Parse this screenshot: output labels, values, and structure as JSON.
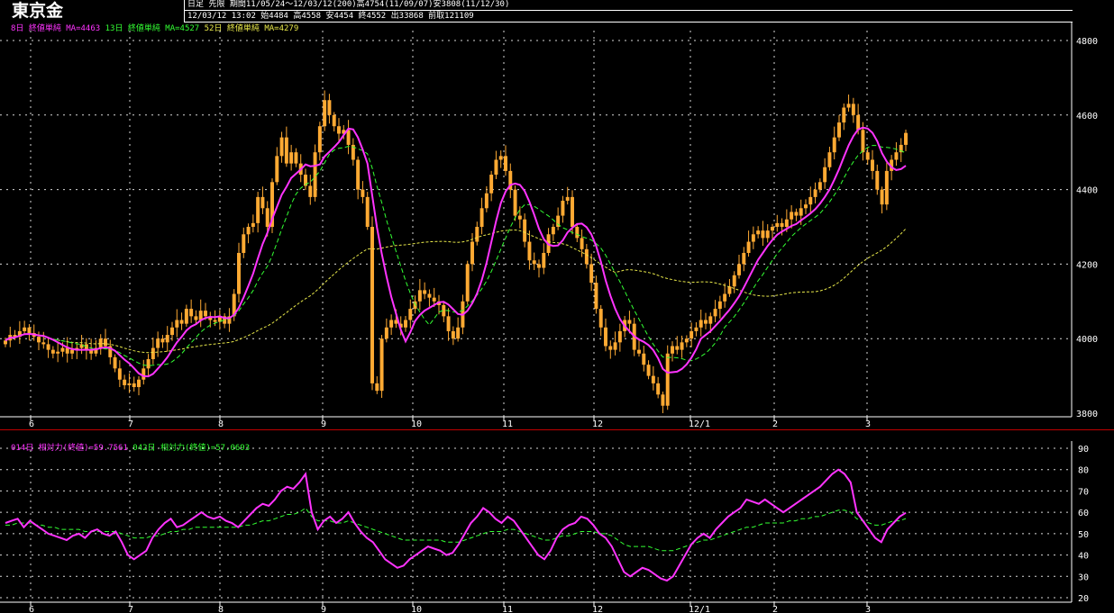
{
  "header": {
    "title": "東京金",
    "mode": "日足",
    "contract": "先限",
    "period": "期間11/05/24〜12/03/12(200)",
    "high": "高4754(11/09/07)",
    "low": "安3808(11/12/30)",
    "ohlc": "12/03/12 13:02 始4484 高4558 安4454 終4552 出33868 前取121109"
  },
  "legend_main": [
    {
      "text": "8日 終値単純 MA=4463",
      "color": "#ff33ff"
    },
    {
      "text": "13日 終値単純 MA=4527",
      "color": "#33ff33"
    },
    {
      "text": "52日 終値単純 MA=4279",
      "color": "#e8e84a"
    }
  ],
  "legend_sub": [
    {
      "text": "014日 相対力(終値)=59.7561",
      "color": "#ff33ff"
    },
    {
      "text": "042日 相対力(終値)=57.0693",
      "color": "#33ff33"
    }
  ],
  "colors": {
    "candle": "#ffaa33",
    "ma8": "#ff33ff",
    "ma13": "#33ff33",
    "ma52": "#e8e84a",
    "grid": "#ffffff",
    "separator": "#c00000"
  },
  "chart_data": [
    {
      "type": "candlestick",
      "title": "東京金",
      "ylim": [
        3800,
        4800
      ],
      "yticks": [
        3800,
        4000,
        4200,
        4400,
        4600,
        4800
      ],
      "xlabels": [
        "6",
        "7",
        "8",
        "9",
        "10",
        "11",
        "12",
        "12/1",
        "2",
        "3"
      ],
      "close": [
        3995,
        4010,
        4005,
        4020,
        4030,
        4015,
        4005,
        3990,
        3985,
        3970,
        3960,
        3965,
        3975,
        3960,
        3970,
        3975,
        3985,
        3970,
        3960,
        3975,
        4000,
        3980,
        3950,
        3920,
        3890,
        3875,
        3880,
        3870,
        3890,
        3920,
        3945,
        3975,
        4000,
        3990,
        4010,
        4030,
        4050,
        4040,
        4080,
        4060,
        4050,
        4075,
        4060,
        4050,
        4045,
        4060,
        4040,
        4060,
        4120,
        4230,
        4280,
        4300,
        4310,
        4380,
        4350,
        4300,
        4420,
        4490,
        4540,
        4470,
        4500,
        4470,
        4440,
        4410,
        4380,
        4500,
        4570,
        4640,
        4600,
        4570,
        4550,
        4560,
        4520,
        4480,
        4400,
        4380,
        4300,
        3880,
        3860,
        4000,
        4030,
        4050,
        4040,
        4030,
        4050,
        4080,
        4100,
        4130,
        4120,
        4110,
        4100,
        4090,
        4060,
        4020,
        4000,
        4030,
        4100,
        4200,
        4260,
        4300,
        4350,
        4390,
        4440,
        4480,
        4490,
        4450,
        4400,
        4330,
        4320,
        4260,
        4210,
        4200,
        4190,
        4230,
        4280,
        4300,
        4330,
        4370,
        4380,
        4300,
        4270,
        4240,
        4200,
        4150,
        4080,
        4030,
        3980,
        3970,
        3990,
        4020,
        4050,
        4040,
        3970,
        3960,
        3930,
        3900,
        3880,
        3850,
        3820,
        3960,
        3980,
        3970,
        3990,
        4000,
        4020,
        4030,
        4050,
        4040,
        4060,
        4080,
        4100,
        4120,
        4140,
        4170,
        4200,
        4230,
        4260,
        4280,
        4290,
        4270,
        4290,
        4300,
        4310,
        4300,
        4320,
        4340,
        4330,
        4350,
        4360,
        4380,
        4400,
        4420,
        4460,
        4500,
        4540,
        4580,
        4620,
        4630,
        4600,
        4560,
        4500,
        4480,
        4450,
        4400,
        4360,
        4450,
        4480,
        4500,
        4520,
        4552
      ],
      "ma8_last": 4463,
      "ma13_last": 4527,
      "ma52_last": 4279
    },
    {
      "type": "line",
      "ylim": [
        20,
        90
      ],
      "yticks": [
        20,
        30,
        40,
        50,
        60,
        70,
        80,
        90
      ],
      "xlabels": [
        "6",
        "7",
        "8",
        "9",
        "10",
        "11",
        "12",
        "12/1",
        "2",
        "3"
      ],
      "series": [
        {
          "name": "014日 相対力(終値)",
          "values": [
            55,
            56,
            57,
            53,
            56,
            54,
            52,
            50,
            49,
            48,
            47,
            49,
            50,
            48,
            51,
            52,
            50,
            49,
            51,
            46,
            40,
            38,
            40,
            42,
            48,
            52,
            55,
            57,
            53,
            54,
            56,
            58,
            60,
            58,
            57,
            58,
            56,
            55,
            53,
            56,
            59,
            62,
            64,
            63,
            66,
            70,
            72,
            71,
            74,
            78,
            60,
            52,
            56,
            58,
            55,
            57,
            60,
            55,
            51,
            48,
            46,
            42,
            38,
            36,
            34,
            35,
            38,
            40,
            42,
            44,
            43,
            42,
            40,
            41,
            45,
            50,
            55,
            58,
            62,
            60,
            57,
            55,
            58,
            56,
            52,
            48,
            44,
            40,
            38,
            42,
            48,
            52,
            54,
            55,
            58,
            57,
            54,
            50,
            48,
            44,
            38,
            32,
            30,
            32,
            34,
            33,
            31,
            29,
            28,
            30,
            35,
            40,
            45,
            48,
            50,
            48,
            52,
            55,
            58,
            60,
            62,
            66,
            65,
            64,
            66,
            64,
            62,
            60,
            62,
            64,
            66,
            68,
            70,
            72,
            75,
            78,
            80,
            78,
            74,
            60,
            56,
            52,
            48,
            46,
            52,
            55,
            58,
            59.76
          ]
        },
        {
          "name": "042日 相対力(終値)",
          "values": [
            54,
            54,
            55,
            55,
            55,
            54,
            54,
            53,
            53,
            52,
            52,
            52,
            52,
            51,
            51,
            51,
            51,
            51,
            51,
            50,
            49,
            48,
            48,
            48,
            49,
            49,
            50,
            51,
            51,
            52,
            52,
            53,
            53,
            53,
            53,
            53,
            53,
            53,
            53,
            54,
            54,
            55,
            56,
            56,
            57,
            58,
            59,
            59,
            60,
            62,
            58,
            56,
            56,
            56,
            55,
            55,
            56,
            55,
            54,
            53,
            52,
            51,
            50,
            49,
            48,
            47,
            47,
            47,
            47,
            47,
            47,
            47,
            46,
            46,
            46,
            47,
            48,
            49,
            50,
            51,
            51,
            51,
            52,
            52,
            51,
            50,
            49,
            48,
            47,
            47,
            48,
            49,
            49,
            50,
            51,
            51,
            51,
            50,
            50,
            49,
            47,
            45,
            44,
            44,
            44,
            44,
            43,
            42,
            42,
            42,
            43,
            44,
            45,
            46,
            47,
            47,
            48,
            49,
            50,
            51,
            52,
            53,
            53,
            54,
            55,
            55,
            55,
            55,
            56,
            56,
            57,
            57,
            58,
            58,
            59,
            60,
            61,
            61,
            60,
            57,
            56,
            55,
            54,
            54,
            55,
            56,
            56,
            57.07
          ]
        }
      ]
    }
  ]
}
